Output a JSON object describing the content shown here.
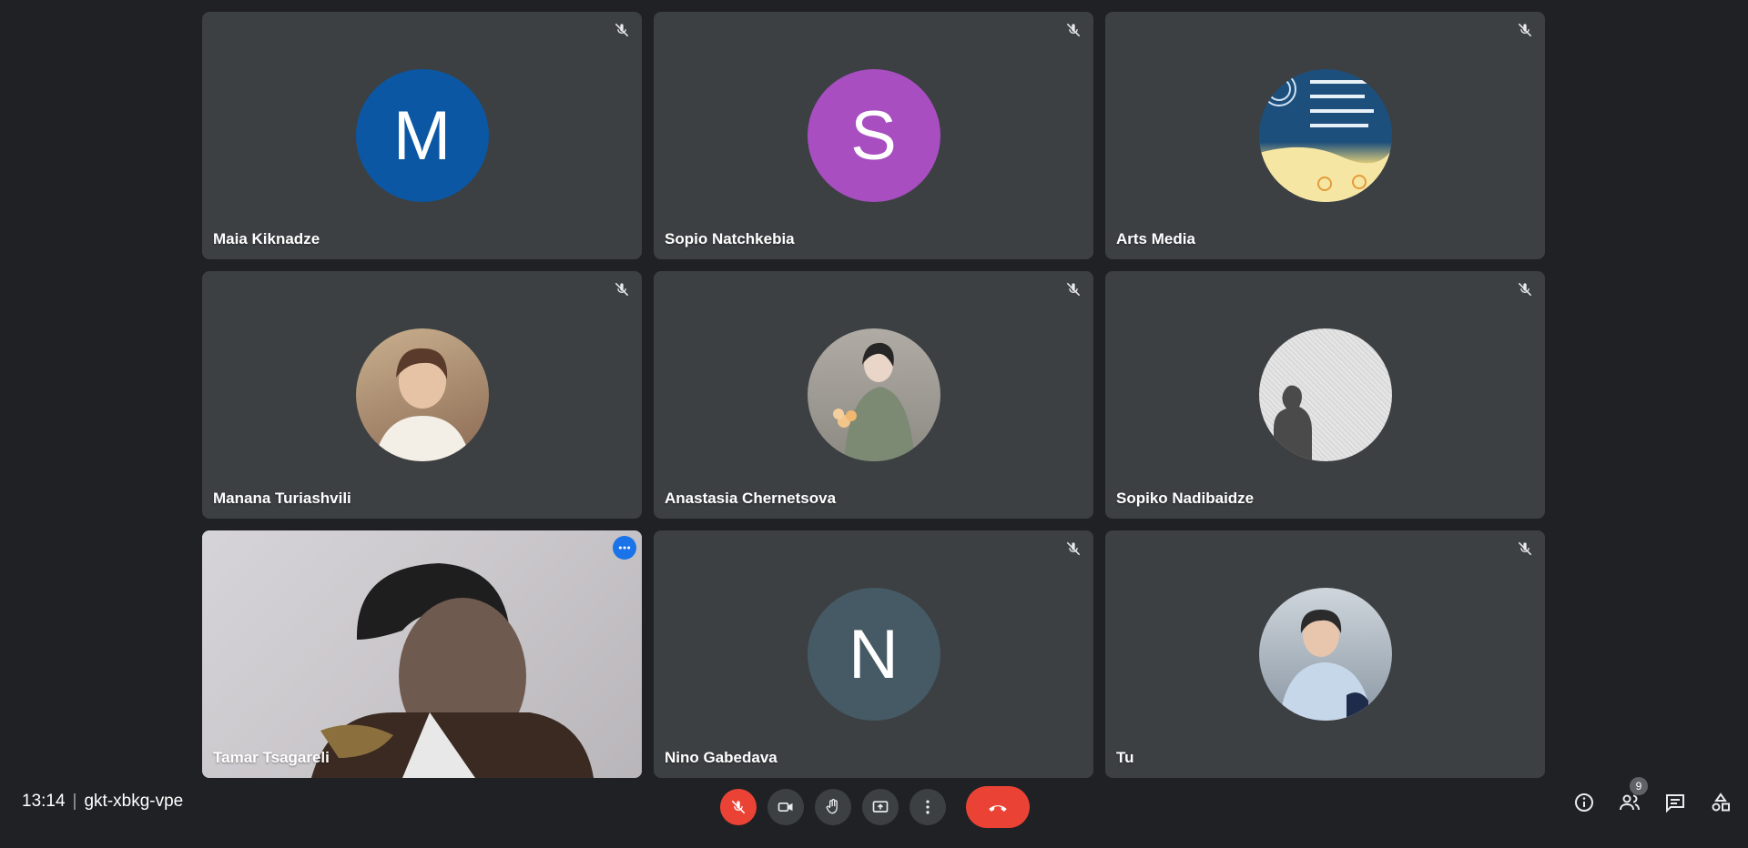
{
  "tiles": [
    {
      "name": "Maia Kiknadze",
      "type": "letter",
      "letter": "M",
      "color": "#0b57a3",
      "muted": true
    },
    {
      "name": "Sopio Natchkebia",
      "type": "letter",
      "letter": "S",
      "color": "#a84ec1",
      "muted": true
    },
    {
      "name": "Arts Media",
      "type": "image",
      "color": "#1b4b7a",
      "muted": true
    },
    {
      "name": "Manana Turiashvili",
      "type": "image",
      "color": "#8b6a54",
      "muted": true
    },
    {
      "name": "Anastasia Chernetsova",
      "type": "image",
      "color": "#8d8a84",
      "muted": true
    },
    {
      "name": "Sopiko Nadibaidze",
      "type": "image",
      "color": "#e3e3e3",
      "muted": true
    },
    {
      "name": "Tamar Tsagareli",
      "type": "video",
      "color": "#c9c6ca",
      "muted": false,
      "active": true
    },
    {
      "name": "Nino Gabedava",
      "type": "letter",
      "letter": "N",
      "color": "#455a64",
      "muted": true
    },
    {
      "name": "Tu",
      "type": "image",
      "color": "#9aa8b8",
      "muted": true
    }
  ],
  "footer": {
    "time": "13:14",
    "separator": "|",
    "meeting_code": "gkt-xbkg-vpe",
    "participants_count": "9"
  }
}
